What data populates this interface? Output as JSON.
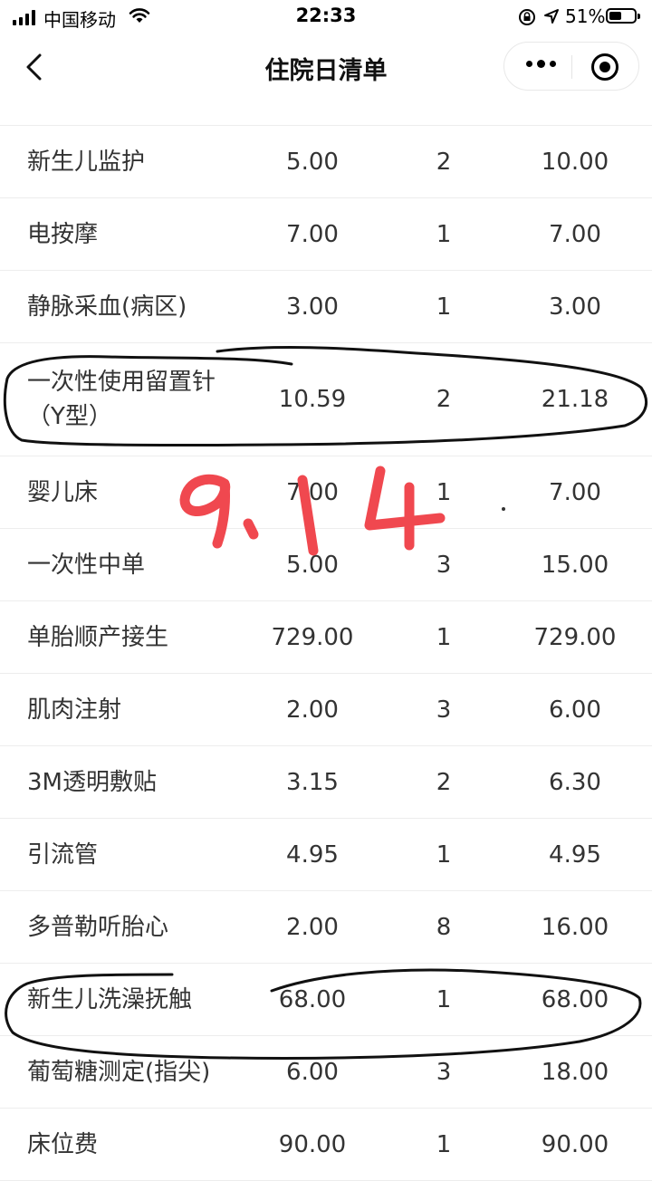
{
  "status_bar": {
    "carrier": "中国移动",
    "time": "22:33",
    "battery_percent": "51%",
    "battery_level": 0.51
  },
  "nav": {
    "title": "住院日清单",
    "back_icon": "chevron-left-icon",
    "more_icon": "more-dots-icon",
    "close_icon": "target-circle-icon"
  },
  "table": {
    "rows": [
      {
        "name": "新生儿监护",
        "price": "5.00",
        "qty": "2",
        "total": "10.00"
      },
      {
        "name": "电按摩",
        "price": "7.00",
        "qty": "1",
        "total": "7.00"
      },
      {
        "name": "静脉采血(病区)",
        "price": "3.00",
        "qty": "1",
        "total": "3.00"
      },
      {
        "name": "一次性使用留置针（Y型）",
        "price": "10.59",
        "qty": "2",
        "total": "21.18"
      },
      {
        "name": "婴儿床",
        "price": "7.00",
        "qty": "1",
        "total": "7.00"
      },
      {
        "name": "一次性中单",
        "price": "5.00",
        "qty": "3",
        "total": "15.00"
      },
      {
        "name": "单胎顺产接生",
        "price": "729.00",
        "qty": "1",
        "total": "729.00"
      },
      {
        "name": "肌肉注射",
        "price": "2.00",
        "qty": "3",
        "total": "6.00"
      },
      {
        "name": "3M透明敷贴",
        "price": "3.15",
        "qty": "2",
        "total": "6.30"
      },
      {
        "name": "引流管",
        "price": "4.95",
        "qty": "1",
        "total": "4.95"
      },
      {
        "name": "多普勒听胎心",
        "price": "2.00",
        "qty": "8",
        "total": "16.00"
      },
      {
        "name": "新生儿洗澡抚触",
        "price": "68.00",
        "qty": "1",
        "total": "68.00"
      },
      {
        "name": "葡萄糖测定(指尖)",
        "price": "6.00",
        "qty": "3",
        "total": "18.00"
      },
      {
        "name": "床位费",
        "price": "90.00",
        "qty": "1",
        "total": "90.00"
      }
    ]
  },
  "annotation": {
    "handwritten_text": "9.14",
    "ink_color": "#f0484f",
    "circle_color": "#111111"
  }
}
